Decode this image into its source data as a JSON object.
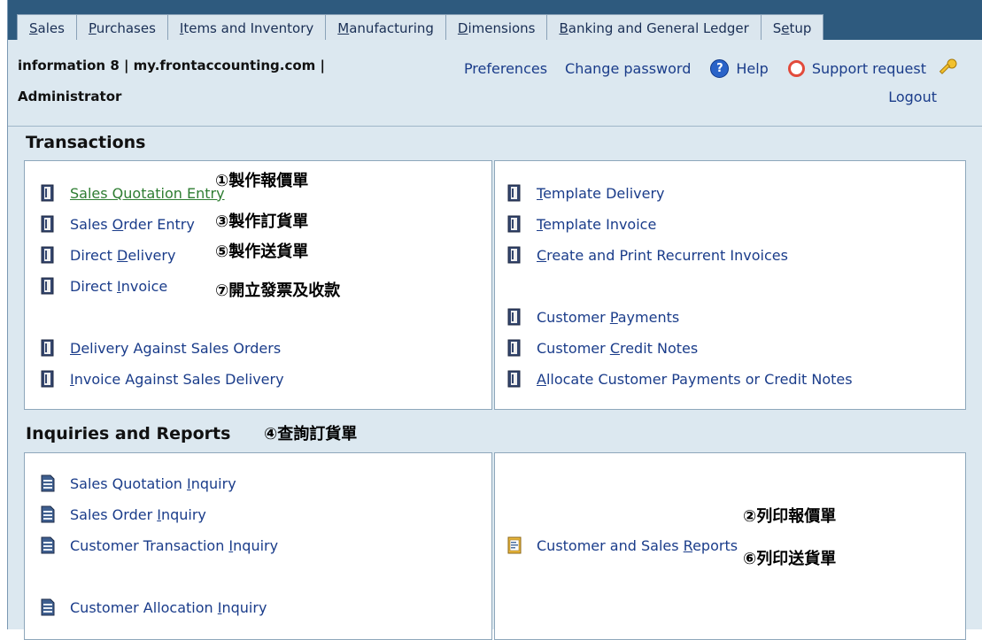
{
  "tabs": [
    {
      "pre": "",
      "u": "S",
      "post": "ales"
    },
    {
      "pre": "",
      "u": "P",
      "post": "urchases"
    },
    {
      "pre": "",
      "u": "I",
      "post": "tems and Inventory"
    },
    {
      "pre": "",
      "u": "M",
      "post": "anufacturing"
    },
    {
      "pre": "",
      "u": "D",
      "post": "imensions"
    },
    {
      "pre": "",
      "u": "B",
      "post": "anking and General Ledger"
    },
    {
      "pre": "S",
      "u": "e",
      "post": "tup"
    }
  ],
  "header": {
    "company": "information 8 | my.frontaccounting.com |",
    "user": "Administrator",
    "preferences": "Preferences",
    "change_password": "Change password",
    "help": "Help",
    "support": "Support request",
    "logout": "Logout"
  },
  "transactions": {
    "title": "Transactions",
    "left": [
      {
        "pre": "Sales ",
        "u": "Q",
        "post": "uotation Entry"
      },
      {
        "pre": "Sales ",
        "u": "O",
        "post": "rder Entry"
      },
      {
        "pre": "Direct ",
        "u": "D",
        "post": "elivery"
      },
      {
        "pre": "Direct ",
        "u": "I",
        "post": "nvoice"
      },
      {
        "pre": "",
        "u": "D",
        "post": "elivery Against Sales Orders"
      },
      {
        "pre": "",
        "u": "I",
        "post": "nvoice Against Sales Delivery"
      }
    ],
    "right": [
      {
        "pre": "",
        "u": "T",
        "post": "emplate Delivery"
      },
      {
        "pre": "",
        "u": "T",
        "post": "emplate Invoice"
      },
      {
        "pre": "",
        "u": "C",
        "post": "reate and Print Recurrent Invoices"
      },
      {
        "pre": "Customer ",
        "u": "P",
        "post": "ayments"
      },
      {
        "pre": "Customer ",
        "u": "C",
        "post": "redit Notes"
      },
      {
        "pre": "",
        "u": "A",
        "post": "llocate Customer Payments or Credit Notes"
      }
    ]
  },
  "inquiries": {
    "title": "Inquiries and Reports",
    "left": [
      {
        "pre": "Sales Quotation ",
        "u": "I",
        "post": "nquiry"
      },
      {
        "pre": "Sales Order ",
        "u": "I",
        "post": "nquiry"
      },
      {
        "pre": "Customer Transaction ",
        "u": "I",
        "post": "nquiry"
      },
      {
        "pre": "Customer Allocation ",
        "u": "I",
        "post": "nquiry"
      }
    ],
    "right": [
      {
        "pre": "Customer and Sales ",
        "u": "R",
        "post": "eports"
      }
    ]
  },
  "notes": {
    "n1": "①製作報價單",
    "n3": "③製作訂貨單",
    "n5": "⑤製作送貨單",
    "n7": "⑦開立發票及收款",
    "n4": "④查詢訂貨單",
    "n2": "②列印報價單",
    "n6": "⑥列印送貨單"
  }
}
